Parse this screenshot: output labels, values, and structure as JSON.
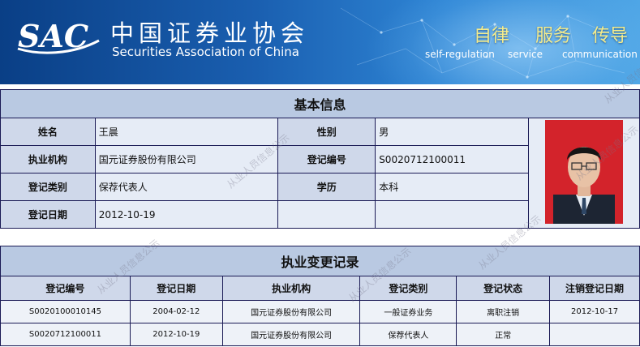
{
  "header": {
    "logo_text": "SAC",
    "org_name_cn": "中国证券业协会",
    "org_name_en": "Securities Association of China",
    "mottos": [
      {
        "cn": "自律",
        "en": "self-regulation"
      },
      {
        "cn": "服务",
        "en": "service"
      },
      {
        "cn": "传导",
        "en": "communication"
      }
    ]
  },
  "basic_info": {
    "title": "基本信息",
    "name_label": "姓名",
    "name": "王晨",
    "gender_label": "性别",
    "gender": "男",
    "org_label": "执业机构",
    "org": "国元证券股份有限公司",
    "reg_no_label": "登记编号",
    "reg_no": "S0020712100011",
    "reg_type_label": "登记类别",
    "reg_type": "保荐代表人",
    "education_label": "学历",
    "education": "本科",
    "reg_date_label": "登记日期",
    "reg_date": "2012-10-19"
  },
  "change_records": {
    "title": "执业变更记录",
    "headers": [
      "登记编号",
      "登记日期",
      "执业机构",
      "登记类别",
      "登记状态",
      "注销登记日期"
    ],
    "rows": [
      [
        "S0020100010145",
        "2004-02-12",
        "国元证券股份有限公司",
        "一般证券业务",
        "离职注销",
        "2012-10-17"
      ],
      [
        "S0020712100011",
        "2012-10-19",
        "国元证券股份有限公司",
        "保荐代表人",
        "正常",
        ""
      ]
    ]
  },
  "watermark_text": "从业人员信息公示",
  "colors": {
    "banner_dark": "#0a3f86",
    "banner_light": "#4fa6e6",
    "section_bg": "#b9c9e2",
    "label_bg": "#cfd8ea",
    "value_bg": "#e6ecf6",
    "border": "#1a1a55",
    "motto_color": "#f5ec8c"
  }
}
